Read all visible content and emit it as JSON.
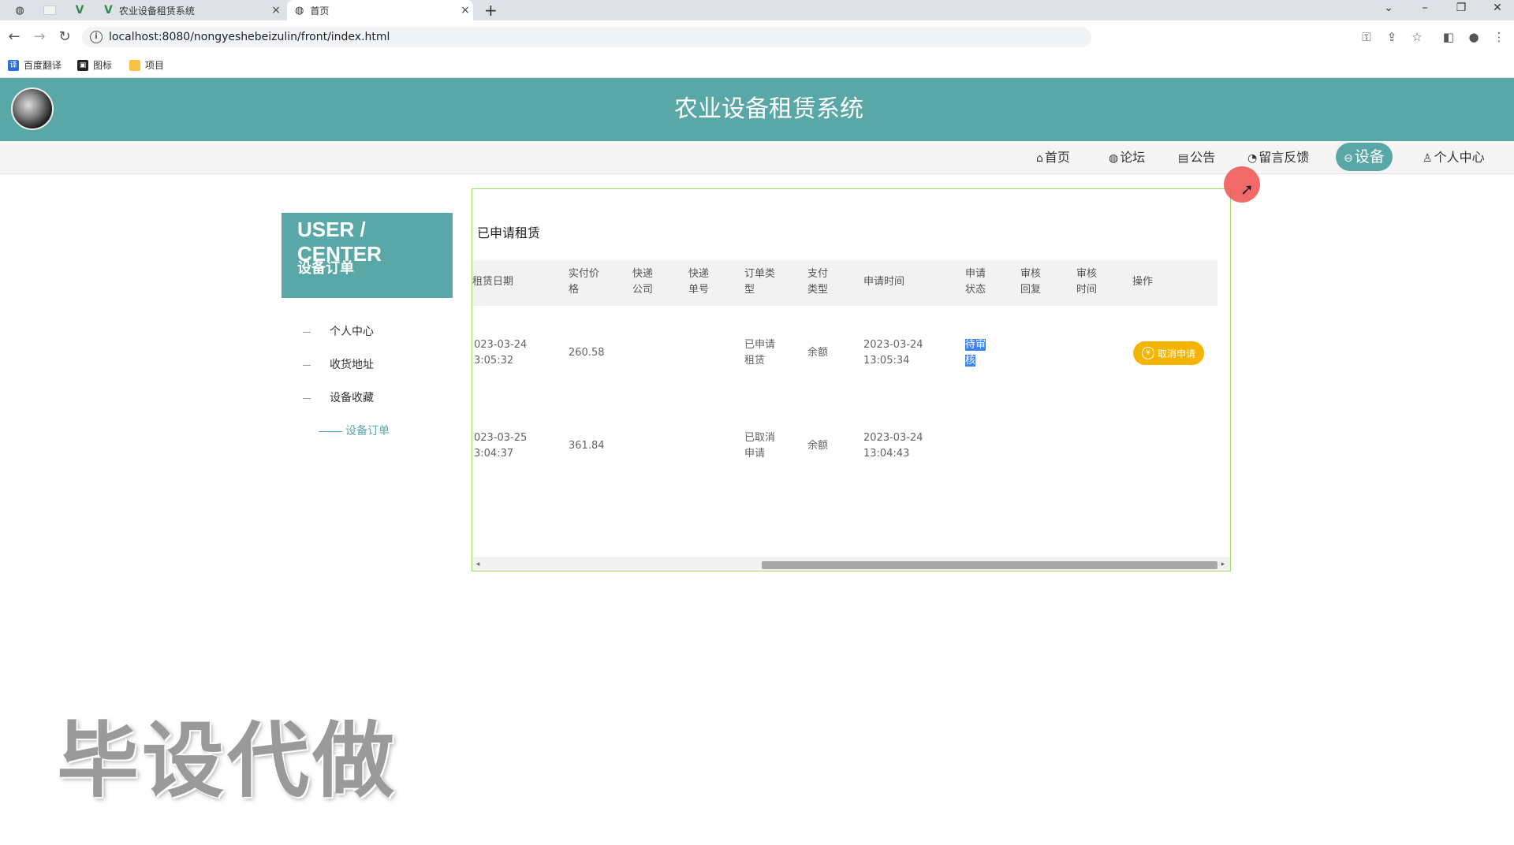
{
  "browser": {
    "tabs": [
      {
        "title": "农业设备租赁系统",
        "active": false
      },
      {
        "title": "首页",
        "active": true
      }
    ],
    "close_glyph": "×",
    "new_tab_glyph": "+",
    "window_controls": {
      "minimize": "–",
      "restore": "❐",
      "close": "✕",
      "dropdown": "⌄"
    },
    "url": "localhost:8080/nongyeshebeizulin/front/index.html",
    "bookmarks": [
      {
        "label": "百度翻译",
        "icon": "translate-icon"
      },
      {
        "label": "图标",
        "icon": "image-icon"
      },
      {
        "label": "项目",
        "icon": "folder-icon"
      }
    ]
  },
  "site": {
    "title": "农业设备租赁系统",
    "nav": [
      {
        "label": "首页",
        "icon": "⌂"
      },
      {
        "label": "论坛",
        "icon": "◍"
      },
      {
        "label": "公告",
        "icon": "▤"
      },
      {
        "label": "留言反馈",
        "icon": "◔"
      },
      {
        "label": "设备",
        "icon": "⊖"
      },
      {
        "label": "个人中心",
        "icon": "♙"
      }
    ],
    "active_nav": "设备"
  },
  "sidebar": {
    "title": "USER / CENTER",
    "subtitle": "设备订单",
    "items": [
      {
        "label": "个人中心"
      },
      {
        "label": "收货地址"
      },
      {
        "label": "设备收藏"
      },
      {
        "label": "设备订单"
      }
    ]
  },
  "panel": {
    "title": "已申请租赁",
    "columns": [
      "租赁日期",
      "实付价格",
      "快递公司",
      "快递单号",
      "订单类型",
      "支付类型",
      "申请时间",
      "申请状态",
      "审核回复",
      "审核时间",
      "操作"
    ],
    "rows": [
      {
        "rent_date": [
          "023-03-24",
          "3:05:32"
        ],
        "price": "260.58",
        "order_type": [
          "已申请",
          "租赁"
        ],
        "pay_type": "余额",
        "apply_time": [
          "2023-03-24",
          "13:05:34"
        ],
        "status": [
          "待审",
          "核"
        ],
        "action": "取消申请"
      },
      {
        "rent_date": [
          "023-03-25",
          "3:04:37"
        ],
        "price": "361.84",
        "order_type": [
          "已取消",
          "申请"
        ],
        "pay_type": "余额",
        "apply_time": [
          "2023-03-24",
          "13:04:43"
        ]
      }
    ],
    "scroll_left": "◂",
    "scroll_right": "▸"
  },
  "watermark": "毕设代做",
  "colors": {
    "accent": "#5aa7a7",
    "button": "#f4b400",
    "panel_border": "#9edc6f",
    "selection": "#3b82f6"
  }
}
